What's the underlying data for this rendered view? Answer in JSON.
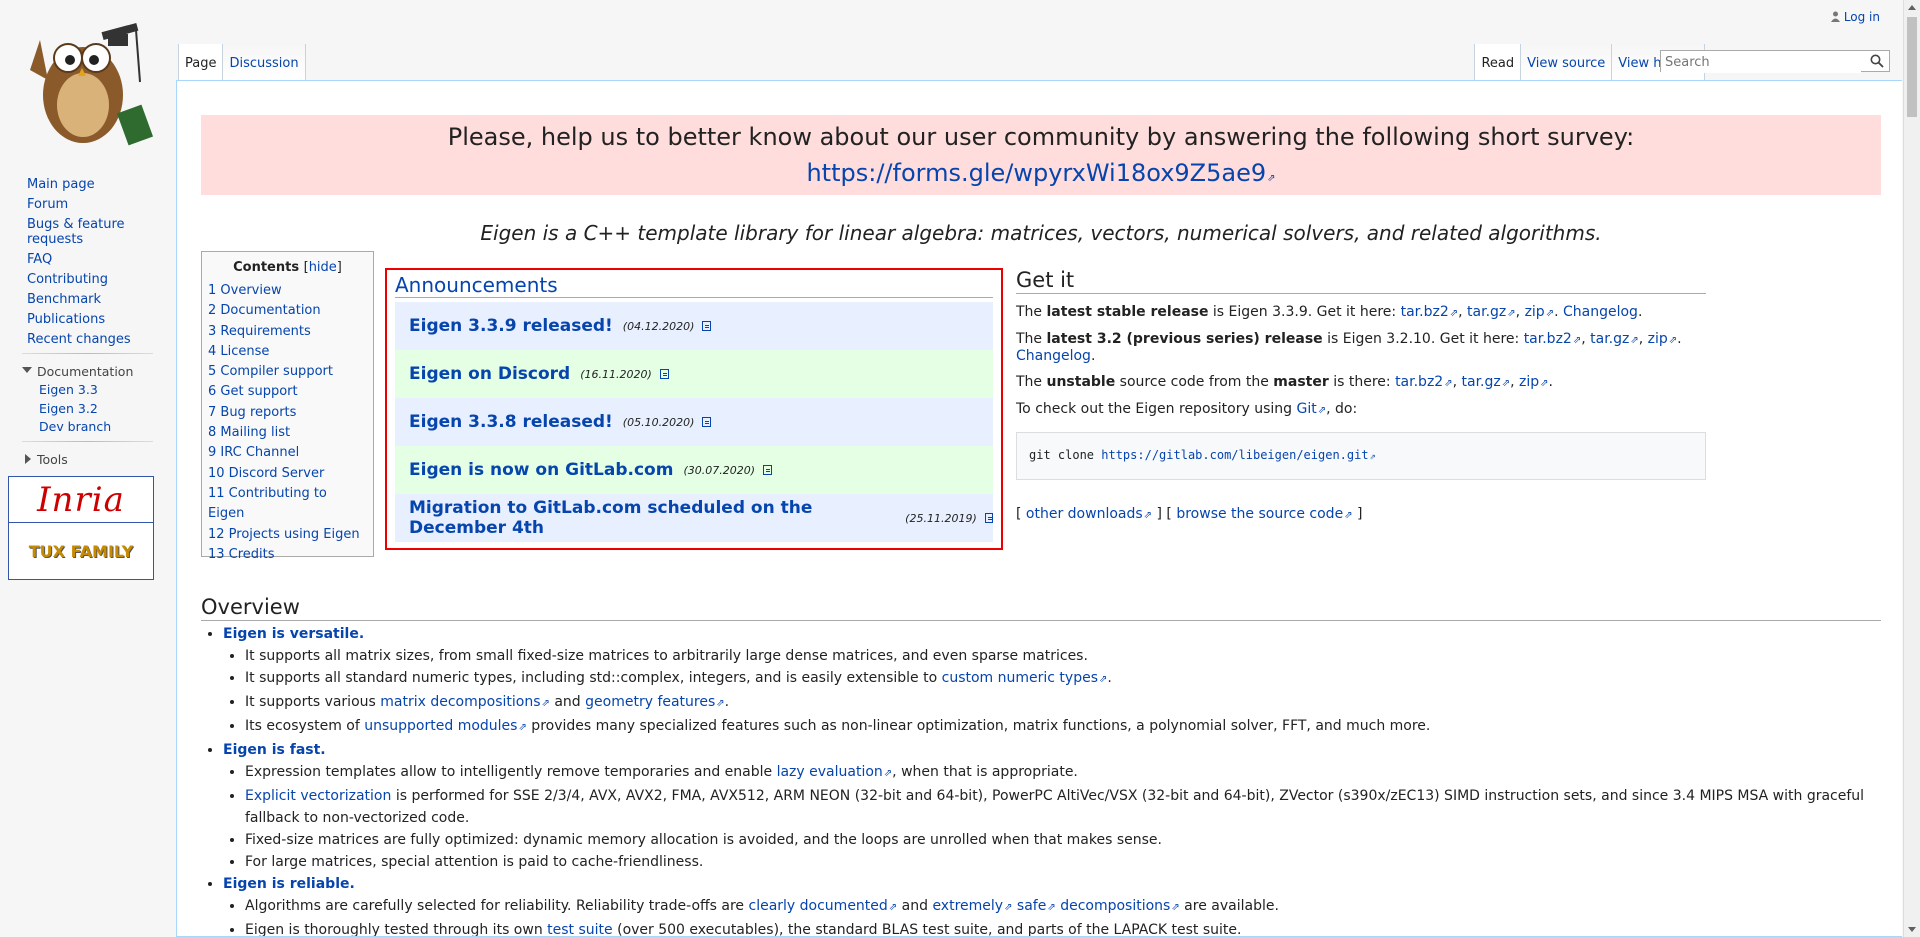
{
  "personal": {
    "login": "Log in"
  },
  "logo": {
    "alt": "Eigen owl mascot"
  },
  "sidebar": {
    "nav": [
      "Main page",
      "Forum",
      "Bugs & feature requests",
      "FAQ",
      "Contributing",
      "Benchmark",
      "Publications",
      "Recent changes"
    ],
    "documentation": {
      "label": "Documentation",
      "items": [
        "Eigen 3.3",
        "Eigen 3.2",
        "Dev branch"
      ]
    },
    "tools": {
      "label": "Tools"
    },
    "sponsors": {
      "inria": "Inria",
      "tux": "TUX FAMILY"
    }
  },
  "tabs": {
    "left": [
      "Page",
      "Discussion"
    ],
    "right": [
      "Read",
      "View source",
      "View history"
    ]
  },
  "search": {
    "placeholder": "Search"
  },
  "survey": {
    "text": "Please, help us to better know about our user community by answering the following short survey:",
    "link": "https://forms.gle/wpyrxWi18ox9Z5ae9"
  },
  "tagline": "Eigen is a C++ template library for linear algebra: matrices, vectors, numerical solvers, and related algorithms.",
  "toc": {
    "title": "Contents",
    "hide": "hide",
    "items": [
      "1 Overview",
      "2 Documentation",
      "3 Requirements",
      "4 License",
      "5 Compiler support",
      "6 Get support",
      "7 Bug reports",
      "8 Mailing list",
      "9 IRC Channel",
      "10 Discord Server",
      "11 Contributing to Eigen",
      "12 Projects using Eigen",
      "13 Credits"
    ]
  },
  "announcements": {
    "heading": "Announcements",
    "items": [
      {
        "title": "Eigen 3.3.9 released!",
        "date": "(04.12.2020)"
      },
      {
        "title": "Eigen on Discord",
        "date": "(16.11.2020)"
      },
      {
        "title": "Eigen 3.3.8 released!",
        "date": "(05.10.2020)"
      },
      {
        "title": "Eigen is now on GitLab.com",
        "date": "(30.07.2020)"
      },
      {
        "title": "Migration to GitLab.com scheduled on the December 4th",
        "date": "(25.11.2019)"
      }
    ]
  },
  "getit": {
    "heading": "Get it",
    "stable": {
      "t1": "The ",
      "bold": "latest stable release",
      "t2": " is Eigen 3.3.9. Get it here: ",
      "l1": "tar.bz2",
      "l2": "tar.gz",
      "l3": "zip",
      "l4": "Changelog",
      "end": "."
    },
    "old": {
      "t1": "The ",
      "bold": "latest 3.2 (previous series) release",
      "t2": " is Eigen 3.2.10. Get it here: ",
      "l1": "tar.bz2",
      "l2": "tar.gz",
      "l3": "zip",
      "l4": "Changelog",
      "end": "."
    },
    "unstable": {
      "t1": "The ",
      "bold1": "unstable",
      "t2": " source code from the ",
      "bold2": "master",
      "t3": " is there: ",
      "l1": "tar.bz2",
      "l2": "tar.gz",
      "l3": "zip",
      "end": "."
    },
    "checkout": {
      "t1": "To check out the Eigen repository using ",
      "l1": "Git",
      "t2": ", do:"
    },
    "code": {
      "cmd": "git clone ",
      "url": "https://gitlab.com/libeigen/eigen.git"
    },
    "downloads": {
      "b1": "[ ",
      "l1": "other downloads",
      "b2": " ] [ ",
      "l2": "browse the source code",
      "b3": " ]"
    }
  },
  "overview": {
    "heading": "Overview",
    "versatile": {
      "title": "Eigen is versatile.",
      "i1": "It supports all matrix sizes, from small fixed-size matrices to arbitrarily large dense matrices, and even sparse matrices.",
      "i2a": "It supports all standard numeric types, including std::complex, integers, and is easily extensible to ",
      "i2l": "custom numeric types",
      "i2b": ".",
      "i3a": "It supports various ",
      "i3l1": "matrix decompositions",
      "i3b": " and ",
      "i3l2": "geometry features",
      "i3c": ".",
      "i4a": "Its ecosystem of ",
      "i4l": "unsupported modules",
      "i4b": " provides many specialized features such as non-linear optimization, matrix functions, a polynomial solver, FFT, and much more."
    },
    "fast": {
      "title": "Eigen is fast.",
      "i1a": "Expression templates allow to intelligently remove temporaries and enable ",
      "i1l": "lazy evaluation",
      "i1b": ", when that is appropriate.",
      "i2l": "Explicit vectorization",
      "i2b": " is performed for SSE 2/3/4, AVX, AVX2, FMA, AVX512, ARM NEON (32-bit and 64-bit), PowerPC AltiVec/VSX (32-bit and 64-bit), ZVector (s390x/zEC13) SIMD instruction sets, and since 3.4 MIPS MSA with graceful fallback to non-vectorized code.",
      "i3": "Fixed-size matrices are fully optimized: dynamic memory allocation is avoided, and the loops are unrolled when that makes sense.",
      "i4": "For large matrices, special attention is paid to cache-friendliness."
    },
    "reliable": {
      "title": "Eigen is reliable.",
      "i1a": "Algorithms are carefully selected for reliability. Reliability trade-offs are ",
      "i1l1": "clearly documented",
      "i1b": " and ",
      "i1l2": "extremely",
      "i1l3": "safe",
      "i1l4": "decompositions",
      "i1c": " are available.",
      "i2a": "Eigen is thoroughly tested through its own ",
      "i2l": "test suite",
      "i2b": " (over 500 executables), the standard BLAS test suite, and parts of the LAPACK test suite."
    }
  }
}
